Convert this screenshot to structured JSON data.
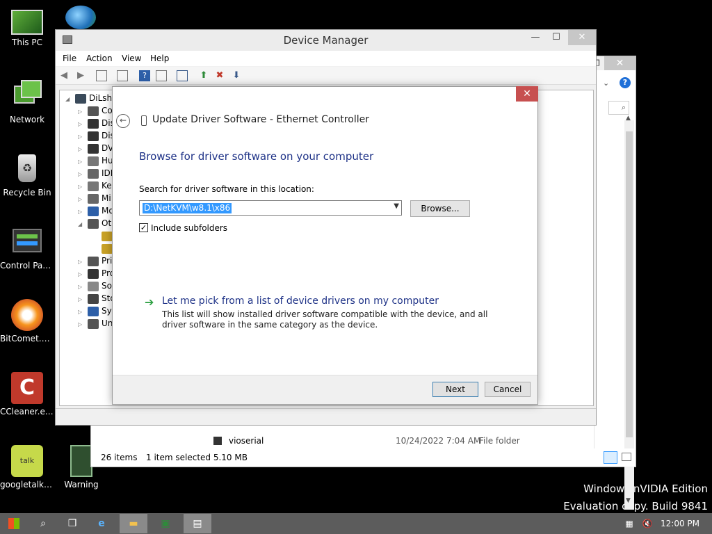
{
  "desktop": {
    "icons": [
      {
        "label": "This PC",
        "icon": "computer-icon"
      },
      {
        "label": "Network",
        "icon": "network-icon"
      },
      {
        "label": "Recycle Bin",
        "icon": "recycle-bin-icon"
      },
      {
        "label": "Control Panel",
        "icon": "control-panel-icon"
      },
      {
        "label": "BitComet.exe",
        "icon": "bitcomet-icon"
      },
      {
        "label": "CCleaner.exe",
        "icon": "ccleaner-icon"
      },
      {
        "label": "googletalk....",
        "icon": "googletalk-icon"
      },
      {
        "label": "Warning",
        "icon": "warning-file-icon"
      }
    ],
    "watermark_line1": "Windows nVIDIA Edition",
    "watermark_line2": "Evaluation copy. Build 9841"
  },
  "explorer": {
    "rows": [
      {
        "name": "vioserial",
        "date": "10/24/2022 7:04 AM",
        "type": "File folder"
      }
    ],
    "status_items": "26 items",
    "status_selected": "1 item selected  5.10 MB"
  },
  "device_manager": {
    "title": "Device Manager",
    "menu": [
      "File",
      "Action",
      "View",
      "Help"
    ],
    "root": "DiLsha",
    "tree": [
      "Co",
      "Dis",
      "Dis",
      "DV",
      "Hu",
      "IDE",
      "Ke",
      "Mi",
      "Mo",
      "Ot",
      "",
      "",
      "Pri",
      "Pro",
      "So",
      "Sto",
      "Sys",
      "Un"
    ]
  },
  "dialog": {
    "header": "Update Driver Software - Ethernet Controller",
    "heading": "Browse for driver software on your computer",
    "search_label": "Search for driver software in this location:",
    "path_value": "D:\\NetKVM\\w8.1\\x86",
    "browse_label": "Browse...",
    "include_subfolders_label": "Include subfolders",
    "include_subfolders_checked": true,
    "pick_link": "Let me pick from a list of device drivers on my computer",
    "pick_desc": "This list will show installed driver software compatible with the device, and all driver software in the same category as the device.",
    "next_label": "Next",
    "cancel_label": "Cancel"
  },
  "taskbar": {
    "clock": "12:00 PM"
  },
  "colors": {
    "accent_blue": "#1e3287",
    "close_red": "#c75050",
    "selection": "#3399ff"
  }
}
